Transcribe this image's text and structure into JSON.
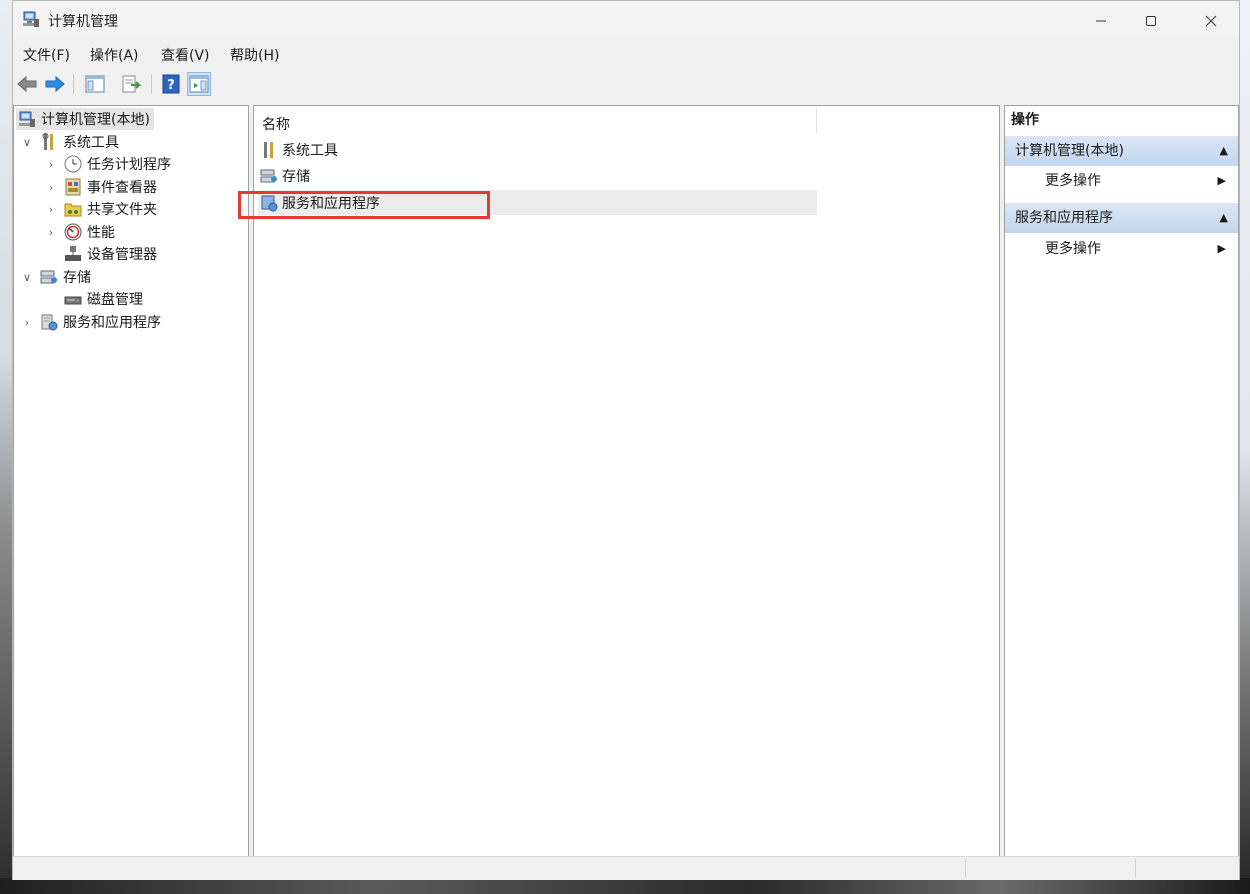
{
  "window": {
    "title": "计算机管理"
  },
  "menubar": {
    "items": [
      "文件(F)",
      "操作(A)",
      "查看(V)",
      "帮助(H)"
    ]
  },
  "tree": {
    "root": "计算机管理(本地)",
    "system_tools": "系统工具",
    "task_scheduler": "任务计划程序",
    "event_viewer": "事件查看器",
    "shared_folders": "共享文件夹",
    "performance": "性能",
    "device_manager": "设备管理器",
    "storage": "存储",
    "disk_management": "磁盘管理",
    "services_apps": "服务和应用程序"
  },
  "list": {
    "header_name": "名称",
    "items": [
      "系统工具",
      "存储",
      "服务和应用程序"
    ],
    "selected_index": 2
  },
  "actions": {
    "title": "操作",
    "sections": [
      {
        "header": "计算机管理(本地)",
        "more": "更多操作"
      },
      {
        "header": "服务和应用程序",
        "more": "更多操作"
      }
    ]
  },
  "colors": {
    "highlight_box": "#e53935",
    "action_header": "#c9daef",
    "selection": "#e9e9e9"
  }
}
